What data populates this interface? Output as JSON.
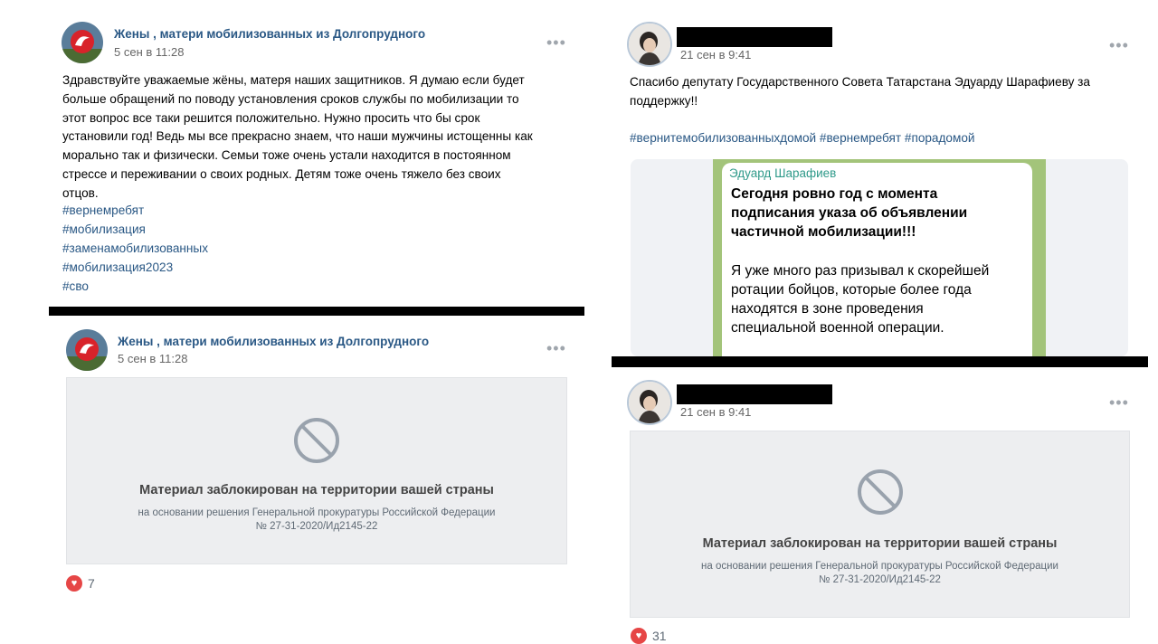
{
  "left": {
    "post1": {
      "author": "Жены , матери мобилизованных из Долгопрудного",
      "time": "5 сен в 11:28",
      "more": "•••",
      "text_lines": [
        "Здравствуйте уважаемые жёны, матеря наших защитников. Я думаю если будет",
        "больше обращений по поводу установления сроков службы по мобилизации то",
        "этот вопрос все таки решится положительно. Нужно просить что бы срок",
        "установили год! Ведь мы все прекрасно знаем, что наши мужчины истощенны как",
        "морально так и физически. Семьи тоже очень устали находится в постоянном",
        "стрессе и переживании о своих родных. Детям тоже очень тяжело без своих",
        "отцов."
      ],
      "hashtags": [
        "#вернемребят",
        "#мобилизация",
        "#заменамобилизованных",
        "#мобилизация2023",
        "#сво"
      ]
    },
    "post2": {
      "author": "Жены , матери мобилизованных из Долгопрудного",
      "time": "5 сен в 11:28",
      "more": "•••",
      "blocked_title": "Материал заблокирован на территории вашей страны",
      "blocked_sub1": "на основании решения Генеральной прокуратуры Российской Федерации",
      "blocked_sub2": "№ 27-31-2020/Ид2145-22",
      "likes": "7"
    }
  },
  "right": {
    "post1": {
      "time": "21 сен в 9:41",
      "more": "•••",
      "text_lines": [
        "Спасибо депутату Государственного Совета Татарстана Эдуарду Шарафиеву за",
        "поддержку!!"
      ],
      "hashtags_line": "#вернитемобилизованныхдомой #вернемребят #порадомой",
      "quote_author": "Эдуард Шарафиев",
      "quote_bold": [
        "Сегодня ровно год с момента",
        "подписания указа об объявлении",
        "частичной мобилизации!!!"
      ],
      "quote_normal": [
        "Я уже много раз призывал к скорейшей",
        "ротации бойцов, которые более года",
        "находятся в зоне проведения",
        "специальной военной операции."
      ]
    },
    "post2": {
      "time": "21 сен в 9:41",
      "more": "•••",
      "blocked_title": "Материал заблокирован на территории вашей страны",
      "blocked_sub1": "на основании решения Генеральной прокуратуры Российской Федерации",
      "blocked_sub2": "№ 27-31-2020/Ид2145-22",
      "likes": "31"
    }
  },
  "colors": {
    "link": "#2a5885",
    "blocked_bg": "#edeef0",
    "like": "#e64646",
    "quote_green": "#a3c47a"
  },
  "icons": [
    "community-logo-icon",
    "user-photo-icon",
    "more-icon",
    "blocked-icon",
    "heart-icon"
  ]
}
